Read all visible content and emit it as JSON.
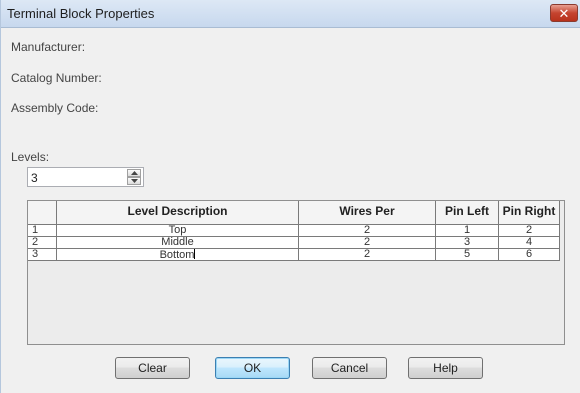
{
  "window": {
    "title": "Terminal Block Properties",
    "close_glyph": "✕"
  },
  "fields": {
    "manufacturer_label": "Manufacturer:",
    "catalog_label": "Catalog Number:",
    "assembly_label": "Assembly Code:",
    "levels_label": "Levels:",
    "levels_value": "3"
  },
  "grid": {
    "headers": {
      "level_description": "Level Description",
      "wires_per": "Wires Per",
      "pin_left": "Pin Left",
      "pin_right": "Pin Right"
    },
    "rows": [
      {
        "num": "1",
        "description": "Top",
        "wires": "2",
        "pin_left": "1",
        "pin_right": "2"
      },
      {
        "num": "2",
        "description": "Middle",
        "wires": "2",
        "pin_left": "3",
        "pin_right": "4"
      },
      {
        "num": "3",
        "description": "Bottom",
        "wires": "2",
        "pin_left": "5",
        "pin_right": "6"
      }
    ]
  },
  "buttons": {
    "clear": "Clear",
    "ok": "OK",
    "cancel": "Cancel",
    "help": "Help"
  }
}
